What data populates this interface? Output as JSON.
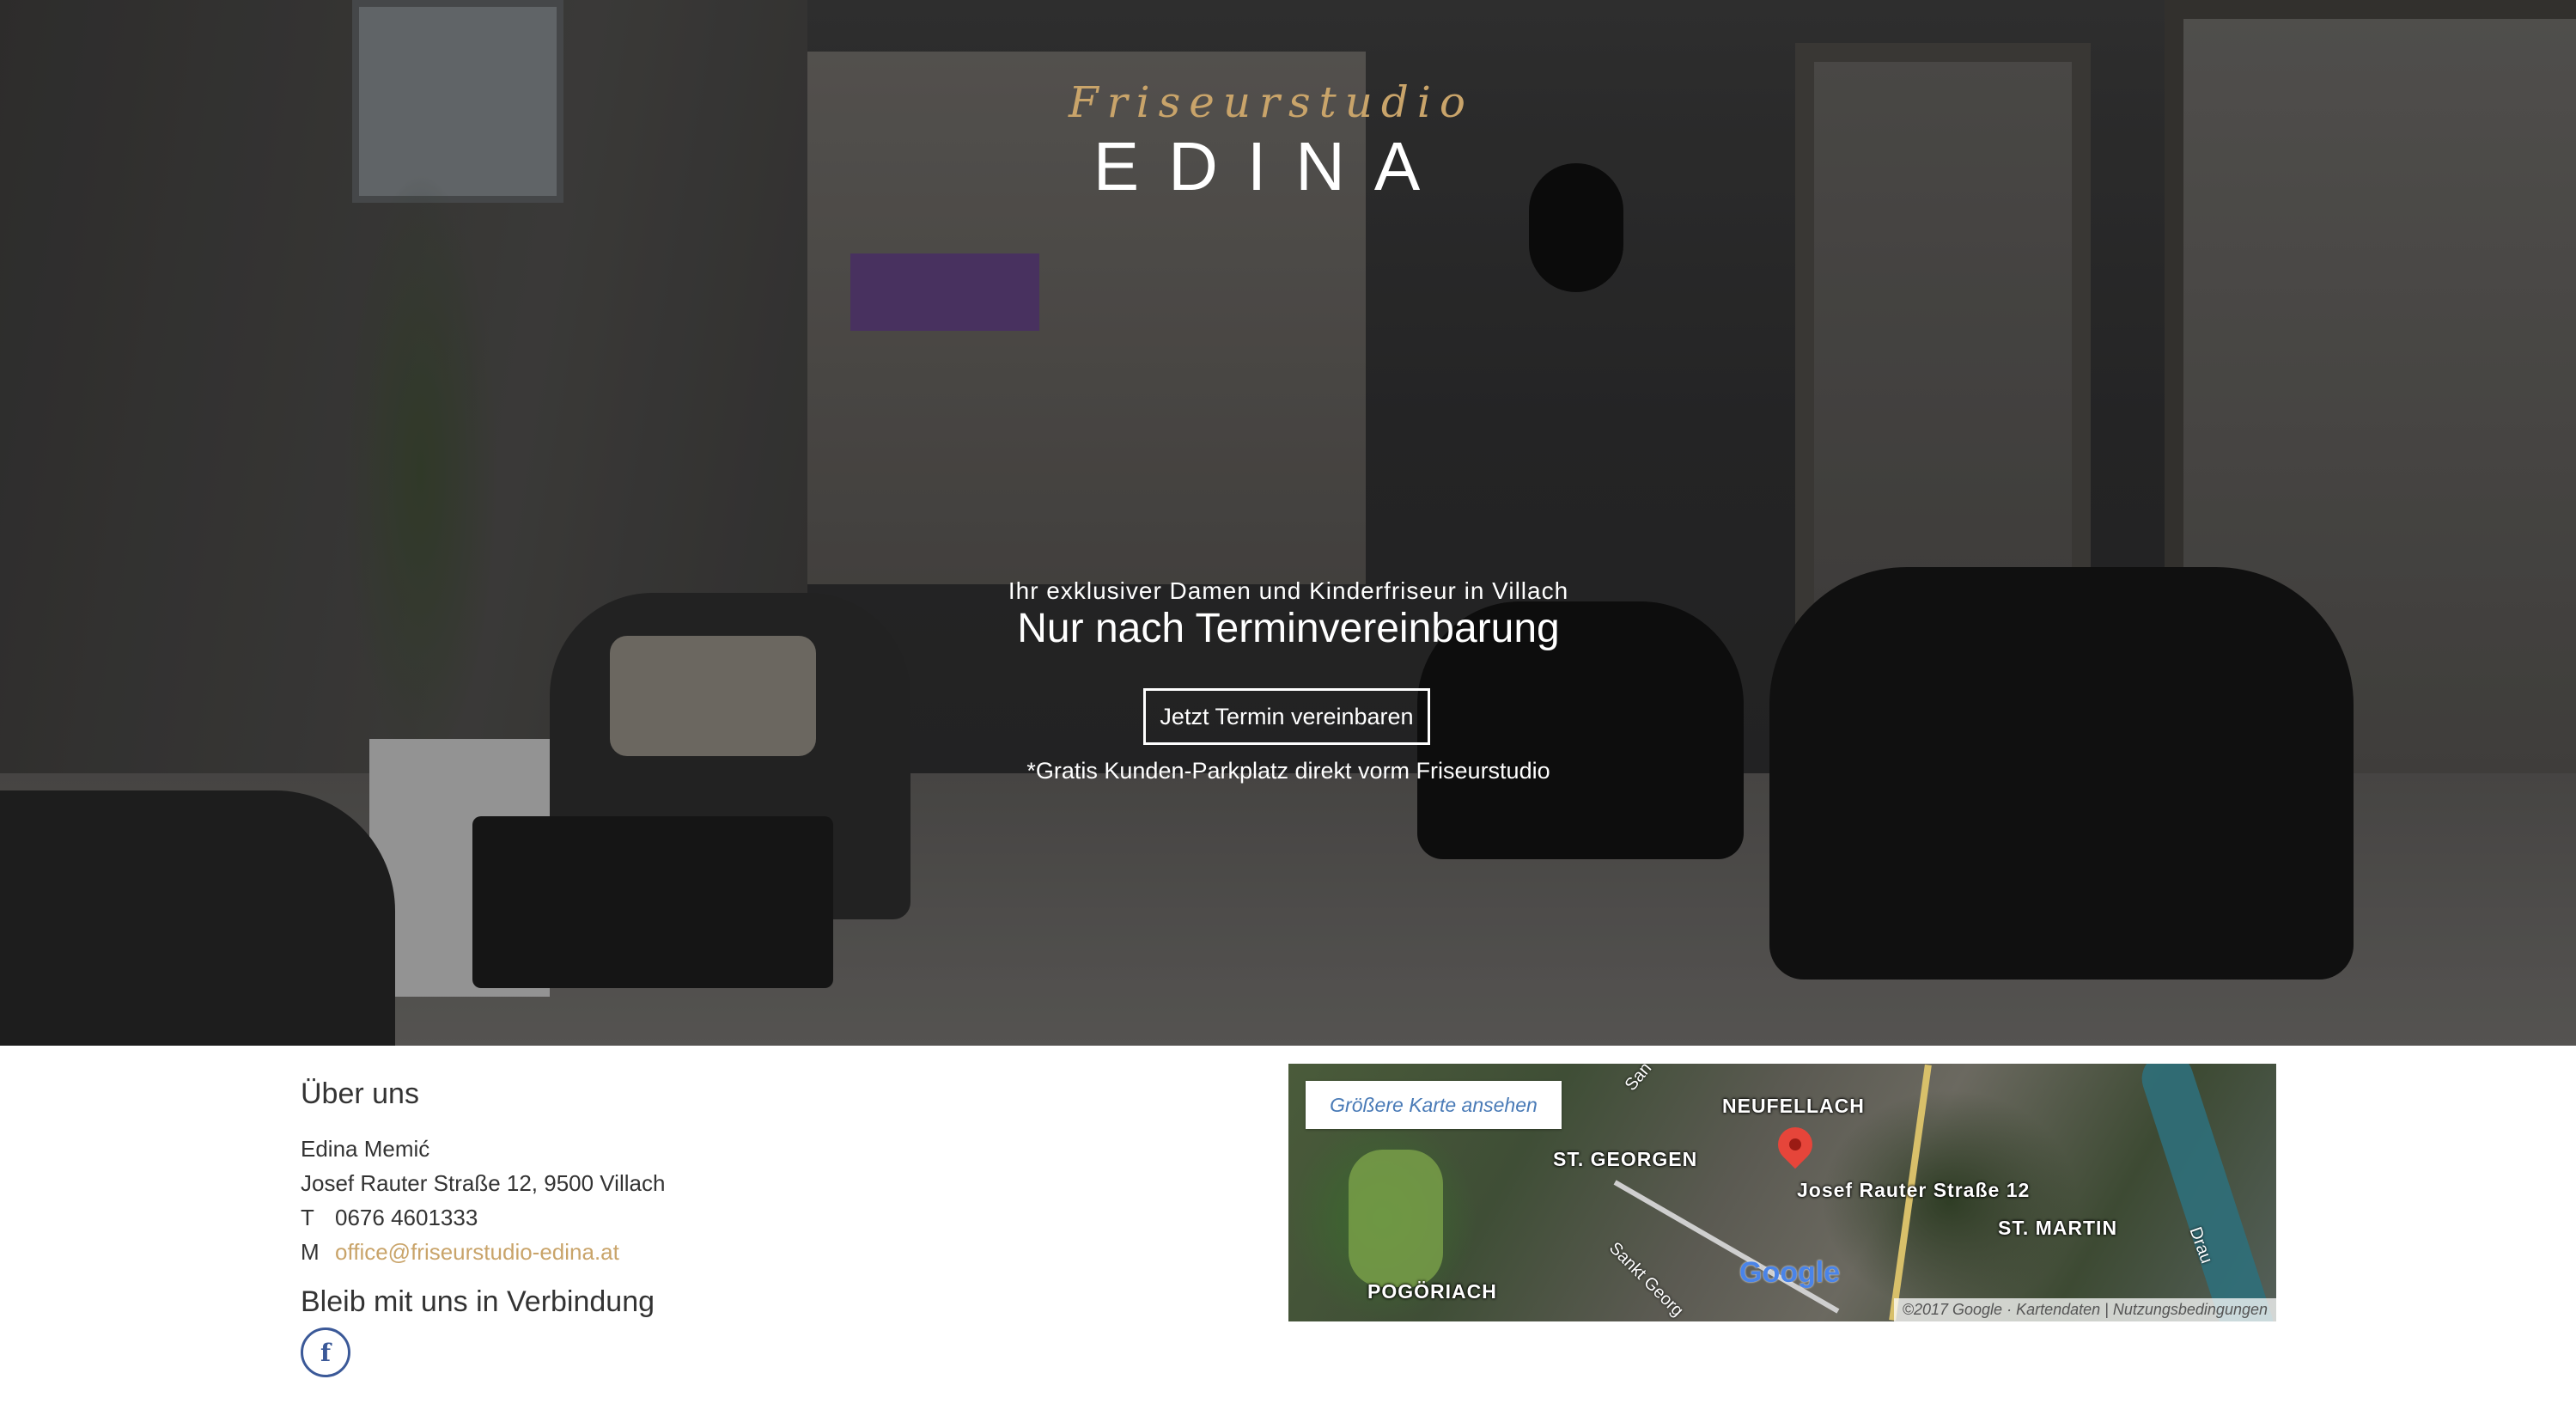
{
  "hero": {
    "brand_script": "Friseurstudio",
    "brand_name": "EDINA",
    "tagline": "Ihr exklusiver Damen und Kinderfriseur in Villach",
    "headline": "Nur nach Terminvereinbarung",
    "cta_label": "Jetzt Termin vereinbaren",
    "parking_note": "*Gratis Kunden-Parkplatz direkt vorm Friseurstudio"
  },
  "about": {
    "title": "Über uns",
    "name": "Edina Memić",
    "address": "Josef Rauter Straße 12, 9500 Villach",
    "phone_label": "T",
    "phone": "0676 4601333",
    "mail_label": "M",
    "email": "office@friseurstudio-edina.at"
  },
  "social": {
    "title": "Bleib mit uns in Verbindung",
    "facebook_icon": "facebook-icon",
    "facebook_glyph": "f"
  },
  "map": {
    "larger_map_label": "Größere Karte ansehen",
    "labels": {
      "neufellach": "NEUFELLACH",
      "st_georgen": "ST. GEORGEN",
      "address": "Josef Rauter Straße 12",
      "st_martin": "ST. MARTIN",
      "pogoriach": "POGÖRIACH",
      "drau": "Drau",
      "sankt_georgen_road": "Sankt Georg",
      "top_road": "San"
    },
    "google_logo": "Google",
    "copyright": "©2017 Google · Kartendaten",
    "terms": "Nutzungsbedingungen"
  },
  "colors": {
    "accent_gold": "#c9a46a",
    "facebook_blue": "#3b5998",
    "map_link_blue": "#4a7bb7"
  }
}
